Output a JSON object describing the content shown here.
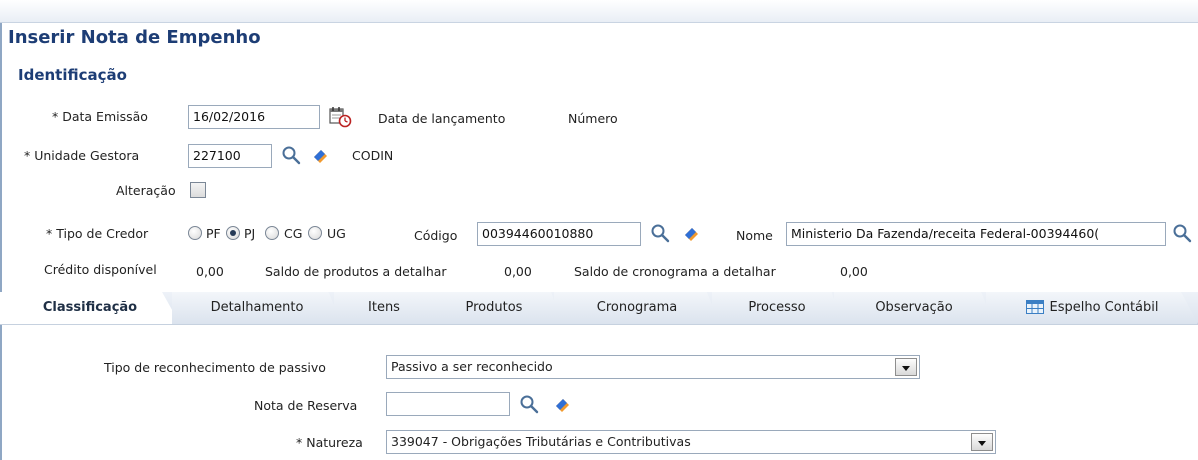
{
  "page": {
    "title": "Inserir Nota de Empenho",
    "section": "Identificação"
  },
  "identificacao": {
    "data_emissao_label": "* Data Emissão",
    "data_emissao_value": "16/02/2016",
    "data_lancamento_label": "Data de lançamento",
    "numero_label": "Número",
    "unidade_gestora_label": "* Unidade Gestora",
    "unidade_gestora_value": "227100",
    "unidade_gestora_name": "CODIN",
    "alteracao_label": "Alteração",
    "tipo_credor_label": "* Tipo de Credor",
    "tipo_credor_options": [
      "PF",
      "PJ",
      "CG",
      "UG"
    ],
    "tipo_credor_selected": "PJ",
    "codigo_label": "Código",
    "codigo_value": "00394460010880",
    "nome_label": "Nome",
    "nome_value": "Ministerio Da Fazenda/receita Federal-00394460(",
    "credito_label": "Crédito disponível",
    "credito_value": "0,00",
    "saldo_produtos_label": "Saldo de produtos a detalhar",
    "saldo_produtos_value": "0,00",
    "saldo_cronograma_label": "Saldo de cronograma a detalhar",
    "saldo_cronograma_value": "0,00"
  },
  "tabs": [
    {
      "label": "Classificação",
      "active": true
    },
    {
      "label": "Detalhamento",
      "active": false
    },
    {
      "label": "Itens",
      "active": false
    },
    {
      "label": "Produtos",
      "active": false
    },
    {
      "label": "Cronograma",
      "active": false
    },
    {
      "label": "Processo",
      "active": false
    },
    {
      "label": "Observação",
      "active": false
    },
    {
      "label": "Espelho Contábil",
      "active": false
    }
  ],
  "classificacao": {
    "tipo_reconhecimento_label": "Tipo de reconhecimento de passivo",
    "tipo_reconhecimento_value": "Passivo a ser reconhecido",
    "nota_reserva_label": "Nota de Reserva",
    "nota_reserva_value": "",
    "natureza_label": "* Natureza",
    "natureza_value": "339047 - Obrigações Tributárias e Contributivas"
  },
  "icons": {
    "calendar": "calendar-icon",
    "search": "search-icon",
    "eraser": "eraser-icon",
    "table": "table-icon"
  },
  "colors": {
    "title": "#1d3d75",
    "eraser_blue": "#2f6fd6",
    "eraser_orange": "#f29a2e"
  }
}
